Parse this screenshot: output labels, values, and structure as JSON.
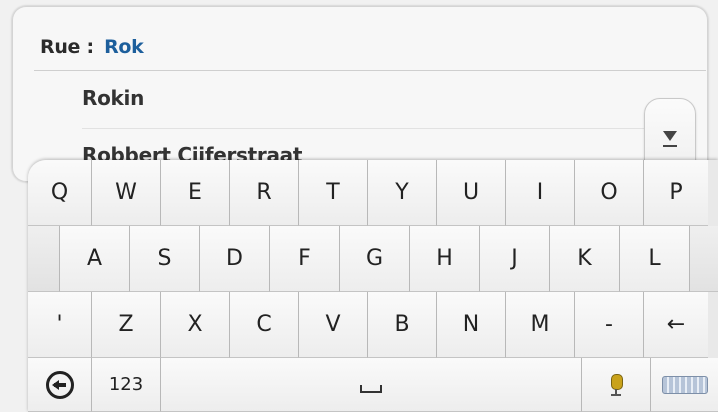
{
  "search": {
    "label": "Rue :",
    "value": "Rok"
  },
  "results": [
    {
      "name": "Rokin"
    },
    {
      "name": "Robbert Cijferstraat"
    }
  ],
  "scroll": {
    "icon": "chevron-down-icon"
  },
  "keyboard": {
    "row1": [
      "Q",
      "W",
      "E",
      "R",
      "T",
      "Y",
      "U",
      "I",
      "O",
      "P"
    ],
    "row2": [
      "A",
      "S",
      "D",
      "F",
      "G",
      "H",
      "J",
      "K",
      "L"
    ],
    "row3": [
      "'",
      "Z",
      "X",
      "C",
      "V",
      "B",
      "N",
      "M",
      "-",
      "←"
    ],
    "row4": {
      "back_icon": "back-icon",
      "numbers": "123",
      "space_icon": "space-icon",
      "mic_icon": "microphone-icon",
      "keyboard_icon": "keyboard-icon"
    }
  },
  "colors": {
    "search_value": "#1d5f9c",
    "background": "#f1f1f1"
  }
}
